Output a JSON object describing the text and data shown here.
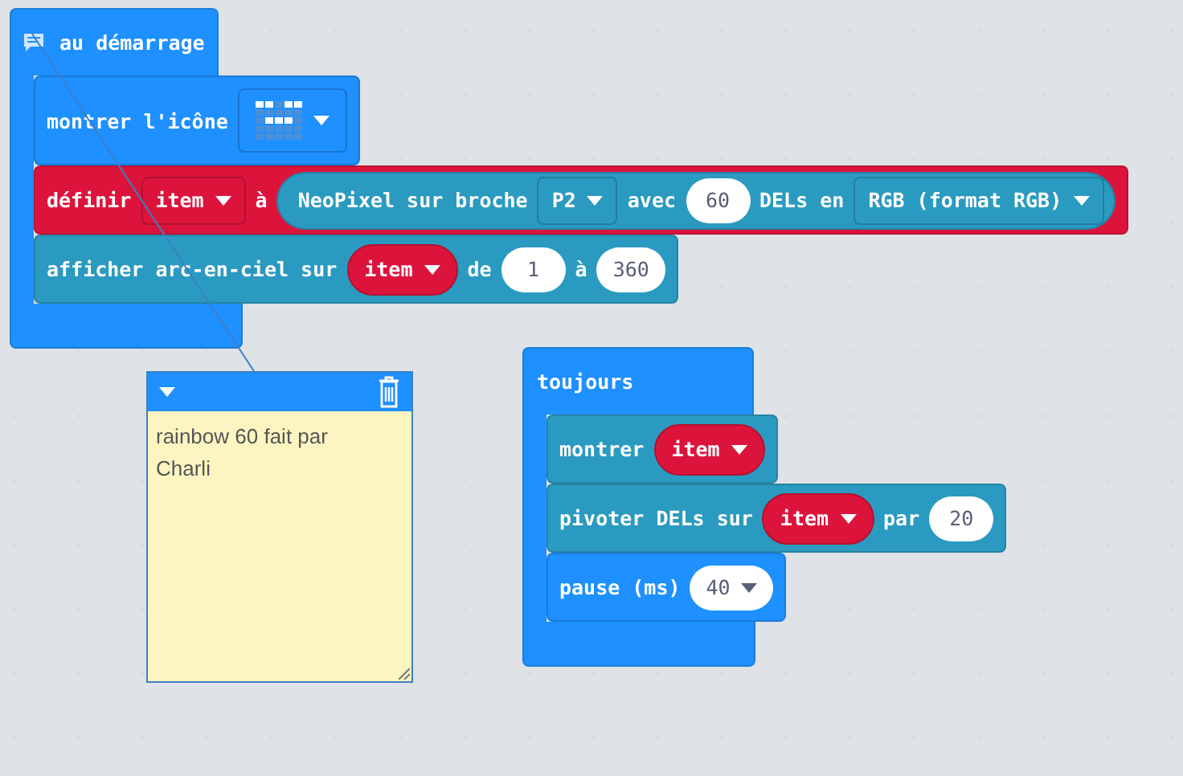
{
  "scripts": [
    {
      "kind": "event",
      "label": "au démarrage",
      "has_comment": true,
      "blocks": [
        {
          "color": "#1e90ff",
          "parts": [
            {
              "kind": "text",
              "text": "montrer l'icône"
            },
            {
              "kind": "led-icon"
            }
          ]
        },
        {
          "color": "#dc143c",
          "parts": [
            {
              "kind": "text",
              "text": "définir"
            },
            {
              "kind": "dropdown",
              "text": "item"
            },
            {
              "kind": "text",
              "text": "à"
            },
            {
              "kind": "reporter",
              "color": "#2b9ac0",
              "parts": [
                {
                  "kind": "text",
                  "text": "NeoPixel sur broche"
                },
                {
                  "kind": "dropdown",
                  "text": "P2"
                },
                {
                  "kind": "text",
                  "text": "avec"
                },
                {
                  "kind": "number",
                  "text": "60"
                },
                {
                  "kind": "text",
                  "text": "DELs en"
                },
                {
                  "kind": "dropdown",
                  "text": "RGB (format RGB)"
                }
              ]
            }
          ]
        },
        {
          "color": "#2b9ac0",
          "parts": [
            {
              "kind": "text",
              "text": "afficher arc-en-ciel sur"
            },
            {
              "kind": "variable",
              "text": "item"
            },
            {
              "kind": "text",
              "text": "de"
            },
            {
              "kind": "number",
              "text": "1"
            },
            {
              "kind": "text",
              "text": "à"
            },
            {
              "kind": "number",
              "text": "360"
            }
          ]
        }
      ]
    },
    {
      "kind": "event",
      "label": "toujours",
      "has_comment": false,
      "blocks": [
        {
          "color": "#2b9ac0",
          "parts": [
            {
              "kind": "text",
              "text": "montrer"
            },
            {
              "kind": "variable",
              "text": "item"
            }
          ]
        },
        {
          "color": "#2b9ac0",
          "parts": [
            {
              "kind": "text",
              "text": "pivoter DELs sur"
            },
            {
              "kind": "variable",
              "text": "item"
            },
            {
              "kind": "text",
              "text": "par"
            },
            {
              "kind": "number",
              "text": "20"
            }
          ]
        },
        {
          "color": "#1e90ff",
          "parts": [
            {
              "kind": "text",
              "text": "pause (ms)"
            },
            {
              "kind": "number-dropdown",
              "text": "40"
            }
          ]
        }
      ]
    }
  ],
  "comment": {
    "text": "rainbow 60 fait par Charli"
  }
}
